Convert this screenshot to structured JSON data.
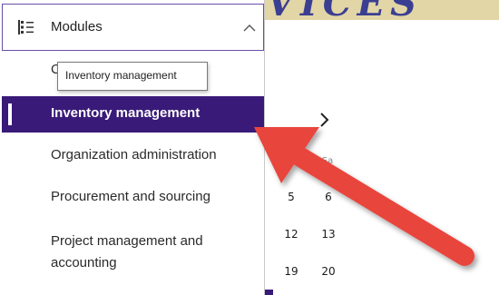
{
  "banner": {
    "text": "VICES"
  },
  "nav": {
    "header": {
      "label": "Modules",
      "icon": "list-icon",
      "chevron": "chevron-up-icon"
    },
    "items": [
      {
        "label": "C"
      },
      {
        "label": "Inventory management",
        "active": true
      },
      {
        "label": "Organization administration"
      },
      {
        "label": "Procurement and sourcing"
      },
      {
        "label": "Project management and accounting"
      }
    ],
    "tooltip": "Inventory management"
  },
  "calendar": {
    "partial_label": "Sa",
    "days": [
      "5",
      "6",
      "12",
      "13",
      "19",
      "20"
    ]
  },
  "colors": {
    "accent": "#3a1a78",
    "header_border": "#6a4ea6",
    "arrow": "#e8453c"
  }
}
